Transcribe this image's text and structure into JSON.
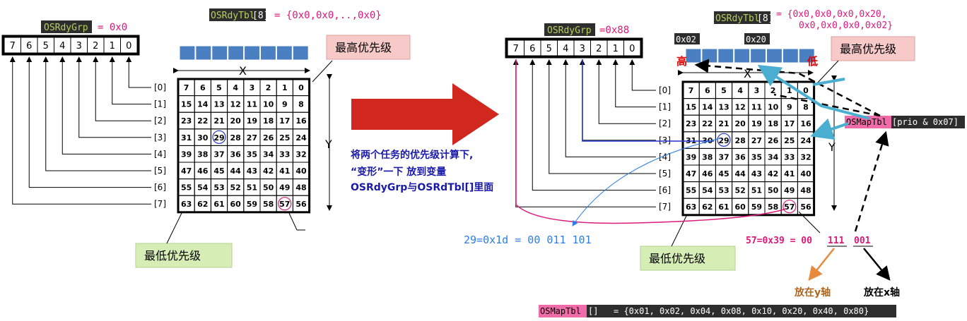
{
  "left": {
    "grp_label": "OSRdyGrp",
    "grp_value": "= 0x0",
    "tbl_label": "OSRdyTbl",
    "tbl_index": "[8]",
    "tbl_value": "= {0x0,0x0,..,0x0}",
    "bits": [
      "7",
      "6",
      "5",
      "4",
      "3",
      "2",
      "1",
      "0"
    ],
    "row_labels": [
      "[0]",
      "[1]",
      "[2]",
      "[3]",
      "[4]",
      "[5]",
      "[6]",
      "[7]"
    ],
    "x_label": "X",
    "y_label": "Y",
    "highest_label": "最高优先级",
    "lowest_label": "最低优先级",
    "circled": [
      "29",
      "57"
    ]
  },
  "right": {
    "grp_label": "OSRdyGrp",
    "grp_value": "=0x88",
    "tbl_label": "OSRdyTbl",
    "tbl_index": "[8]",
    "tbl_value_line1": "= {0x0,0x0,0x0,0x20,",
    "tbl_value_line2": "0x0,0x0,0x0,0x02}",
    "bits": [
      "7",
      "6",
      "5",
      "4",
      "3",
      "2",
      "1",
      "0"
    ],
    "row_labels": [
      "[0]",
      "[1]",
      "[2]",
      "[3]",
      "[4]",
      "[5]",
      "[6]",
      "[7]"
    ],
    "bar_label_a": "0x02",
    "bar_label_b": "0x20",
    "high": "高",
    "low": "低",
    "x_label": "X",
    "y_label": "Y",
    "highest_label": "最高优先级",
    "lowest_label": "最低优先级",
    "maptbl_label": "OSMapTbl",
    "maptbl_expr": "[prio & 0x07]",
    "calc_29": "29=0x1d = 00 011 101",
    "calc_57_prefix": "57=0x39 = 00 ",
    "calc_57_y": "111",
    "calc_57_x": "001",
    "put_y": "放在y轴",
    "put_x": "放在x轴",
    "maptbl_bottom_label": "OSMapTbl",
    "maptbl_bottom_index": "[]",
    "maptbl_bottom_value": "= {0x01, 0x02, 0x04, 0x08, 0x10, 0x20, 0x40, 0x80}",
    "circled": [
      "29",
      "57"
    ]
  },
  "middle": {
    "line1": "将两个任务的优先级计算下,",
    "line2": "“变形”一下 放到变量",
    "line3": "OSRdyGrp与OSRdTbl[]里面"
  },
  "grid": [
    [
      "7",
      "6",
      "5",
      "4",
      "3",
      "2",
      "1",
      "0"
    ],
    [
      "15",
      "14",
      "13",
      "12",
      "11",
      "10",
      "9",
      "8"
    ],
    [
      "23",
      "22",
      "21",
      "20",
      "19",
      "18",
      "17",
      "16"
    ],
    [
      "31",
      "30",
      "29",
      "28",
      "27",
      "26",
      "25",
      "24"
    ],
    [
      "39",
      "38",
      "37",
      "36",
      "35",
      "34",
      "33",
      "32"
    ],
    [
      "47",
      "46",
      "45",
      "44",
      "43",
      "42",
      "41",
      "40"
    ],
    [
      "55",
      "54",
      "53",
      "52",
      "51",
      "50",
      "49",
      "48"
    ],
    [
      "63",
      "62",
      "61",
      "60",
      "59",
      "58",
      "57",
      "56"
    ]
  ],
  "colors": {
    "bar_blue": "#4a7fc1",
    "label_bg": "#2d2d2d",
    "label_green": "#b8d05a",
    "label_pink_text": "#e0167a",
    "red_label": "#e00000",
    "callout_pink": "#f7c9c9",
    "callout_green": "#d6edb6",
    "arrow_red": "#d0281e",
    "teal": "#4aaed0",
    "blue_line": "#2233cc",
    "magenta_line": "#d81b7a",
    "orange": "#e88a3c",
    "text_blue": "#1a1aa8",
    "calc_blue": "#2b7de9"
  }
}
